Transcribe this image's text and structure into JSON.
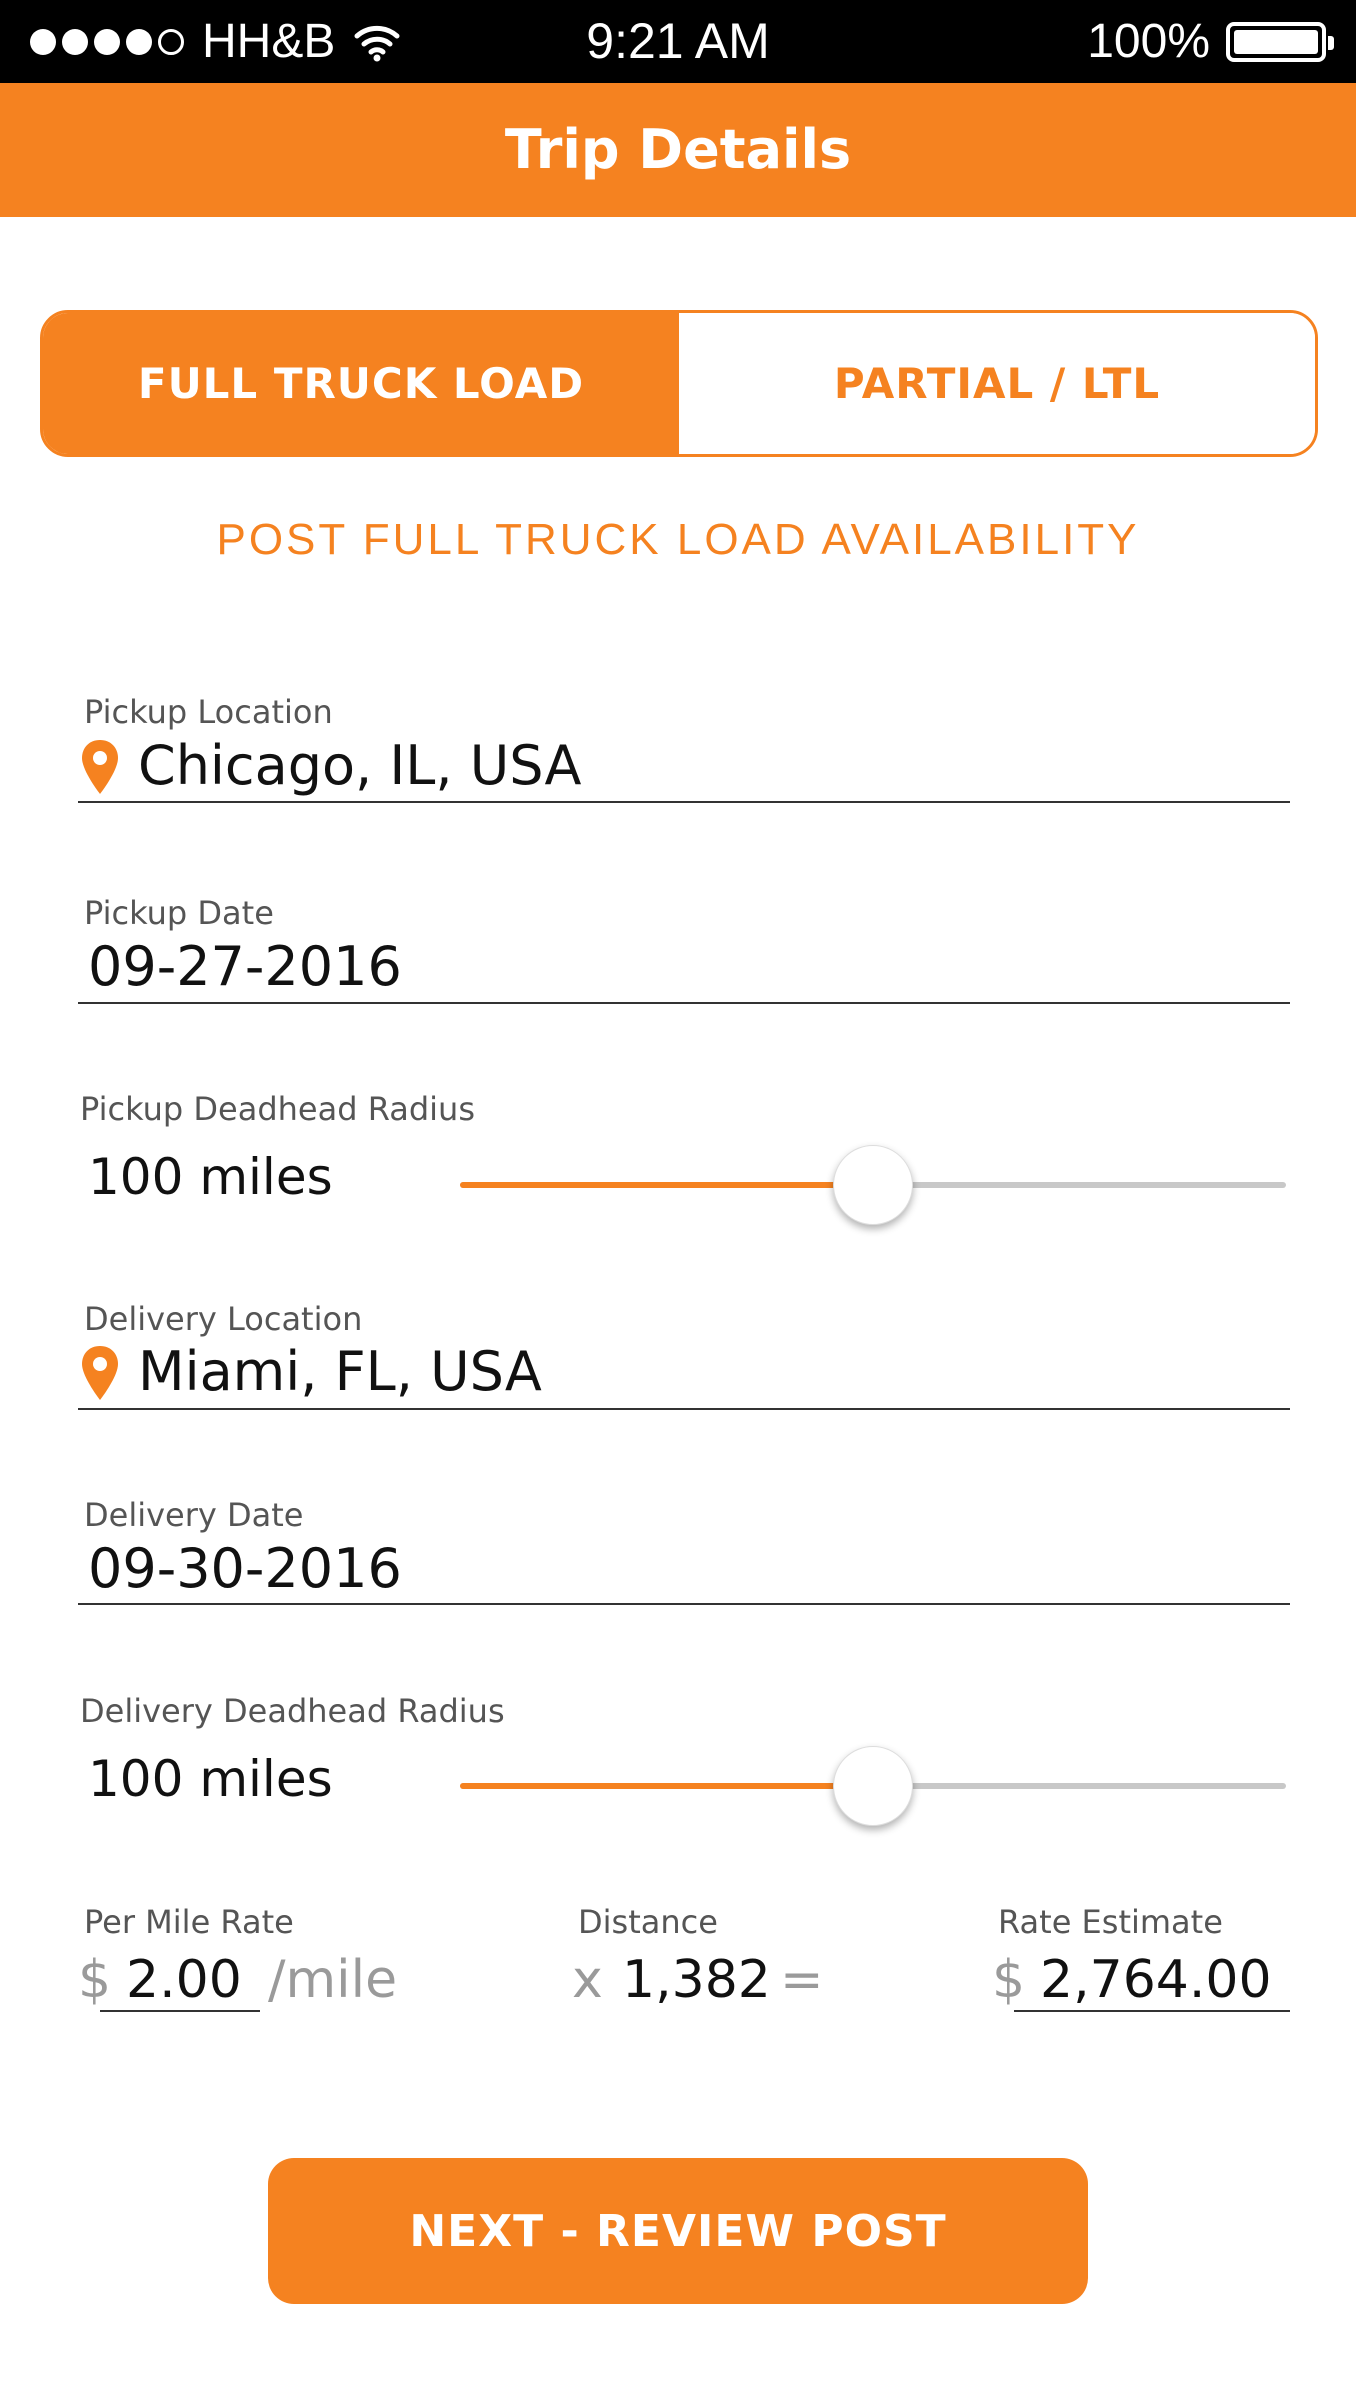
{
  "status_bar": {
    "carrier": "HH&B",
    "time": "9:21 AM",
    "battery": "100%",
    "signal_bars_filled": 4,
    "signal_bars_total": 5
  },
  "header": {
    "title": "Trip Details"
  },
  "segment": {
    "options": [
      "FULL TRUCK LOAD",
      "PARTIAL / LTL"
    ],
    "selected": "FULL TRUCK LOAD"
  },
  "subtitle": "POST FULL TRUCK LOAD AVAILABILITY",
  "form": {
    "pickup_location": {
      "label": "Pickup Location",
      "value": "Chicago, IL, USA"
    },
    "pickup_date": {
      "label": "Pickup Date",
      "value": "09-27-2016"
    },
    "pickup_radius": {
      "label": "Pickup Deadhead Radius",
      "value": "100 miles",
      "slider_level_percent": 50
    },
    "delivery_location": {
      "label": "Delivery Location",
      "value": "Miami, FL, USA"
    },
    "delivery_date": {
      "label": "Delivery Date",
      "value": "09-30-2016"
    },
    "delivery_radius": {
      "label": "Delivery Deadhead Radius",
      "value": "100 miles",
      "slider_level_percent": 50
    }
  },
  "rates": {
    "per_mile_label": "Per Mile Rate",
    "currency_symbol": "$",
    "per_mile_value": "2.00",
    "per_mile_unit": "/mile",
    "distance_label": "Distance",
    "multiply_symbol": "x",
    "distance_value": "1,382",
    "equals_symbol": "=",
    "estimate_label": "Rate Estimate",
    "estimate_value": "2,764.00"
  },
  "next_button": {
    "label": "NEXT - REVIEW POST"
  },
  "colors": {
    "accent": "#f58220",
    "status_bar": "#000000",
    "text": "#111111",
    "label": "#555555"
  },
  "icons": [
    "wifi-icon",
    "battery-icon",
    "location-pin-icon"
  ]
}
